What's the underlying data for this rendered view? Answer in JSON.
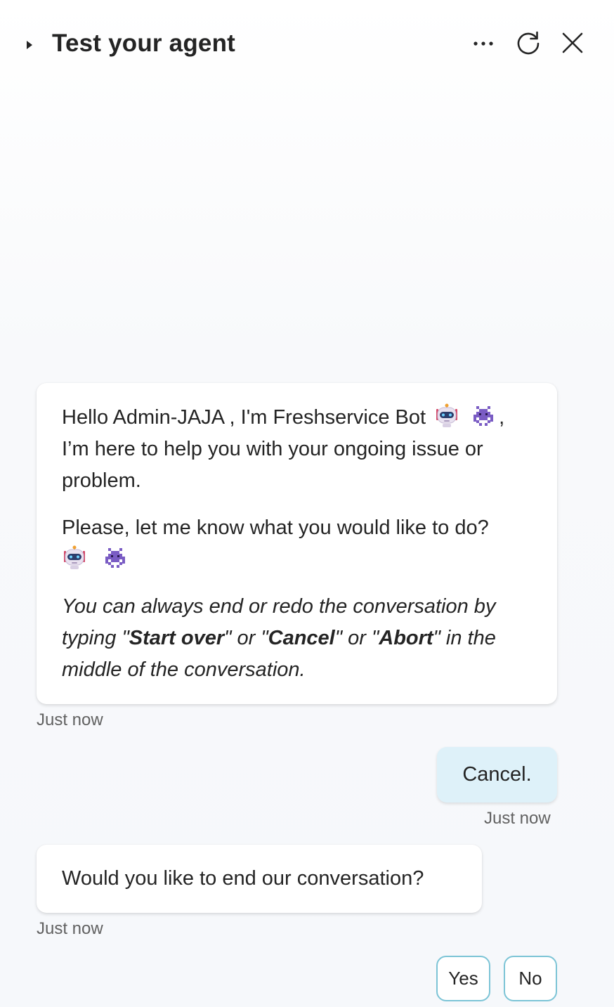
{
  "header": {
    "title": "Test your agent",
    "icons": [
      "caret-right-icon",
      "more-icon",
      "refresh-icon",
      "close-icon"
    ]
  },
  "messages": {
    "welcome": {
      "line1_prefix": "Hello Admin-JAJA , I'm Freshservice Bot",
      "line1_suffix": ",",
      "line1_rest": "I’m here to help you with your ongoing issue or problem.",
      "line2": "Please, let me know what you would like to do?",
      "italic_p1": "You can always end or redo the conversation by typing \"",
      "start_over": "Start over",
      "italic_p2": "\" or \"",
      "cancel": "Cancel",
      "italic_p3": "\" or \"",
      "abort": "Abort",
      "italic_p4": "\" in the middle of the conversation.",
      "timestamp": "Just now",
      "emojis": [
        "robot-emoji",
        "alien-monster-emoji"
      ]
    },
    "user_reply": {
      "text": "Cancel.",
      "timestamp": "Just now"
    },
    "question": {
      "text": "Would you like to end our conversation?",
      "timestamp": "Just now"
    }
  },
  "choices": {
    "yes": "Yes",
    "no": "No"
  },
  "colors": {
    "user_bubble": "#def1f9",
    "choice_border": "#7cc4d6",
    "text": "#242424",
    "timestamp": "#616161"
  }
}
